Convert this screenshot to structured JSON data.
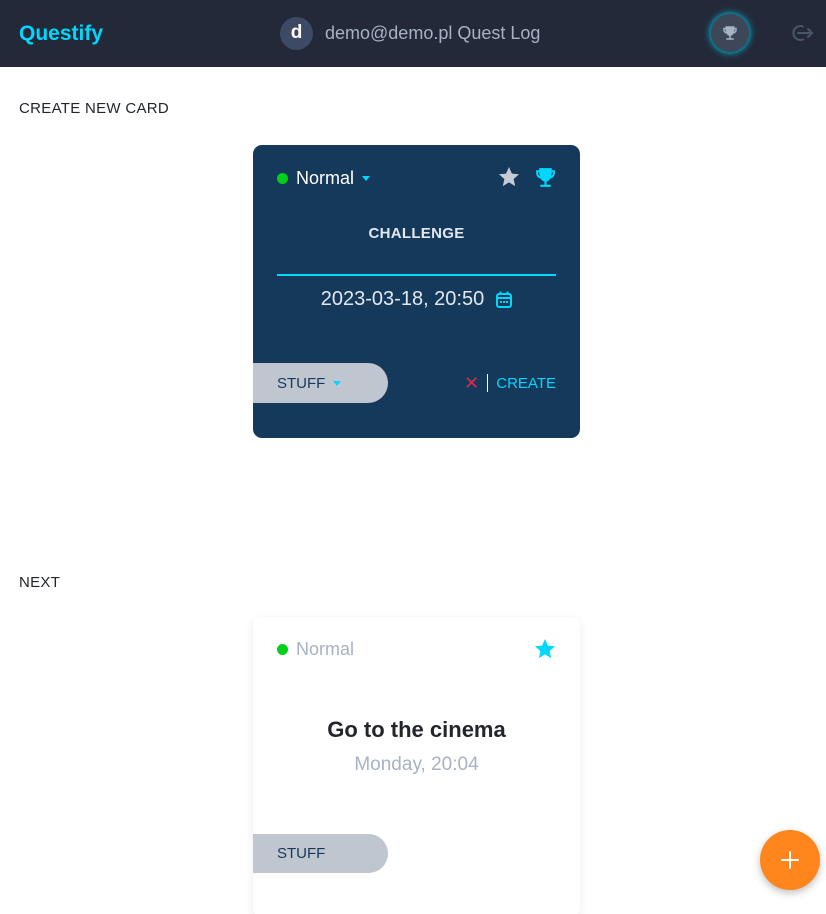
{
  "header": {
    "logo": "Questify",
    "avatar_letter": "d",
    "user_label": "demo@demo.pl Quest Log",
    "icons": [
      "trophy-icon",
      "logout-icon"
    ],
    "colors": {
      "background": "#232938",
      "accent": "#00d7ff"
    }
  },
  "sections": {
    "create": "CREATE NEW CARD",
    "next": "NEXT"
  },
  "edit_card": {
    "difficulty": "Normal",
    "difficulty_color": "#00d118",
    "type": "CHALLENGE",
    "datetime": "2023-03-18, 20:50",
    "category": "STUFF",
    "delete_label": "✕",
    "create_label": "CREATE",
    "colors": {
      "background": "#15395b",
      "create": "#00d7ff",
      "delete": "#e0294a"
    },
    "icons": [
      "star-icon",
      "trophy-icon",
      "calendar-icon"
    ]
  },
  "next_card": {
    "difficulty": "Normal",
    "title": "Go to the cinema",
    "datetime": "Monday, 20:04",
    "category": "STUFF",
    "icons": [
      "star-icon"
    ],
    "star_color": "#00d7ff"
  },
  "fab": {
    "icon": "plus-icon",
    "color": "#ff851c"
  }
}
